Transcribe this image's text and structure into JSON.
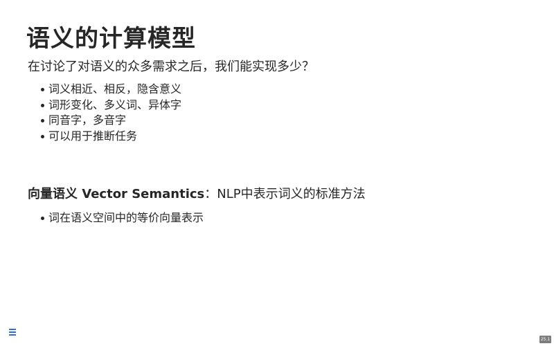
{
  "slide": {
    "title": "语义的计算模型",
    "intro": "在讨论了对语义的众多需求之后，我们能实现多少？",
    "requirements": [
      "词义相近、相反，隐含意义",
      "词形变化、多义词、异体字",
      "同音字，多音字",
      "可以用于推断任务"
    ],
    "section": {
      "heading": "向量语义 Vector Semantics",
      "rest": "：NLP中表示词义的标准方法"
    },
    "section_points": [
      "词在语义空间中的等价向量表示"
    ]
  },
  "controls": {
    "menu_icon": "hamburger-menu-icon",
    "page_number": "25.1"
  },
  "colors": {
    "text": "#262626",
    "menu_icon": "#2d6fd6",
    "page_badge_bg": "#7e7e7e"
  }
}
